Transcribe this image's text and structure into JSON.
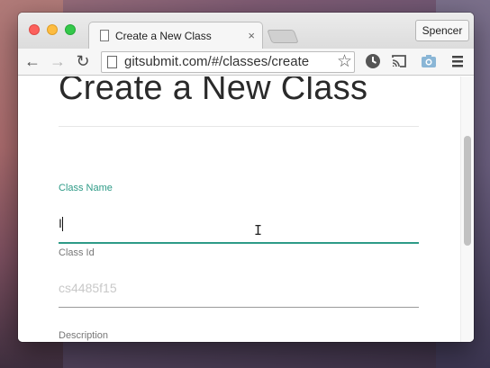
{
  "browser": {
    "tab_title": "Create a New Class",
    "tab_close": "×",
    "profile_name": "Spencer",
    "url": "gitsubmit.com/#/classes/create",
    "nav": {
      "back": "←",
      "forward": "→",
      "reload": "↻"
    },
    "star": "☆",
    "icons": [
      "back-arrow-icon",
      "forward-arrow-icon",
      "reload-icon",
      "page-icon",
      "star-icon",
      "clock-extension-icon",
      "cast-icon",
      "camera-extension-icon",
      "menu-icon"
    ]
  },
  "page": {
    "title": "Create a New Class",
    "fields": {
      "class_name": {
        "label": "Class Name",
        "value": "I"
      },
      "class_id": {
        "label": "Class Id",
        "placeholder": "cs4485f15"
      },
      "description": {
        "label": "Description"
      }
    }
  },
  "colors": {
    "accent": "#2e9b87",
    "traffic_close": "#fc605c",
    "traffic_min": "#fdbc40",
    "traffic_max": "#34c84a"
  }
}
